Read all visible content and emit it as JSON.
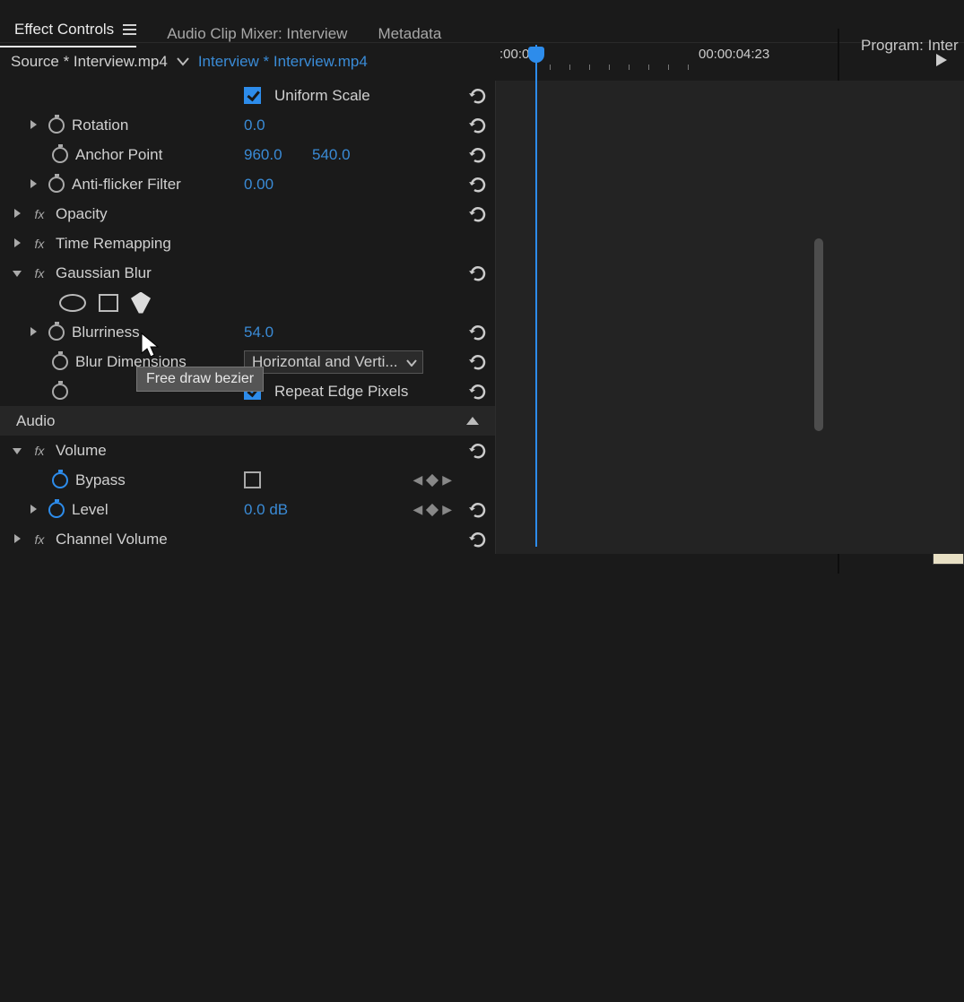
{
  "tabs": {
    "effect_controls": "Effect Controls",
    "audio_mixer": "Audio Clip Mixer: Interview",
    "metadata": "Metadata"
  },
  "program_panel": "Program: Inter",
  "source": {
    "source_label": "Source * Interview.mp4",
    "sequence_label": "Interview * Interview.mp4"
  },
  "timeline": {
    "start": ":00:0",
    "end": "00:00:04:23"
  },
  "props": {
    "uniform_scale": "Uniform Scale",
    "rotation": "Rotation",
    "rotation_val": "0.0",
    "anchor_point": "Anchor Point",
    "anchor_x": "960.0",
    "anchor_y": "540.0",
    "antiflicker": "Anti-flicker Filter",
    "antiflicker_val": "0.00",
    "opacity": "Opacity",
    "time_remap": "Time Remapping",
    "gaussian_blur": "Gaussian Blur",
    "blurriness": "Blurriness",
    "blurriness_val": "54.0",
    "blur_dimensions": "Blur Dimensions",
    "blur_dim_value": "Horizontal and Verti...",
    "repeat_edge": "Repeat Edge Pixels",
    "audio": "Audio",
    "volume": "Volume",
    "bypass": "Bypass",
    "level": "Level",
    "level_val": "0.0 dB",
    "channel_volume": "Channel Volume"
  },
  "tooltip": "Free draw bezier"
}
